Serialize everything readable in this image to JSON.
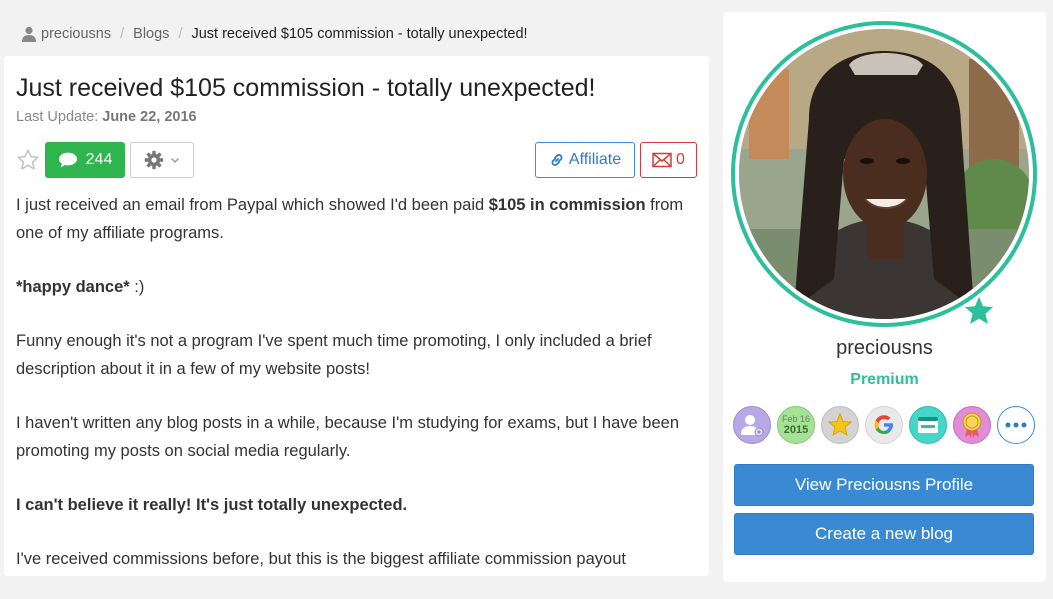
{
  "breadcrumb": {
    "user": "preciousns",
    "section": "Blogs",
    "current": "Just received $105 commission - totally unexpected!"
  },
  "post": {
    "title": "Just received $105 commission - totally unexpected!",
    "last_update_label": "Last Update:",
    "last_update_date": "June 22, 2016",
    "comment_count": "244",
    "affiliate_label": "Affiliate",
    "spam_count": "0",
    "p1_before": "I just received an email from Paypal which showed I'd been paid ",
    "p1_bold": "$105 in commission",
    "p1_after": " from one of my affiliate programs.",
    "p2_bold": "*happy dance*",
    "p2_after": " :)",
    "p3": "Funny enough it's not a program I've spent much time promoting, I only included a brief description about it in a few of my website posts!",
    "p4": "I haven't written any blog posts in a while, because I'm studying for exams, but I have been promoting my posts on social media regularly.",
    "p5_bold": "I can't believe it really! It's just totally unexpected.",
    "p6": "I've received commissions before, but this is the biggest affiliate commission payout"
  },
  "profile": {
    "username": "preciousns",
    "membership": "Premium",
    "badge_date_month": "Feb 16",
    "badge_date_year": "2015",
    "view_profile_label": "View Preciousns Profile",
    "create_blog_label": "Create a new blog"
  },
  "colors": {
    "accent_teal": "#2dbf9c",
    "comment_green": "#2fb54d",
    "primary_blue": "#3a8ad3",
    "spam_red": "#d23b3b"
  }
}
